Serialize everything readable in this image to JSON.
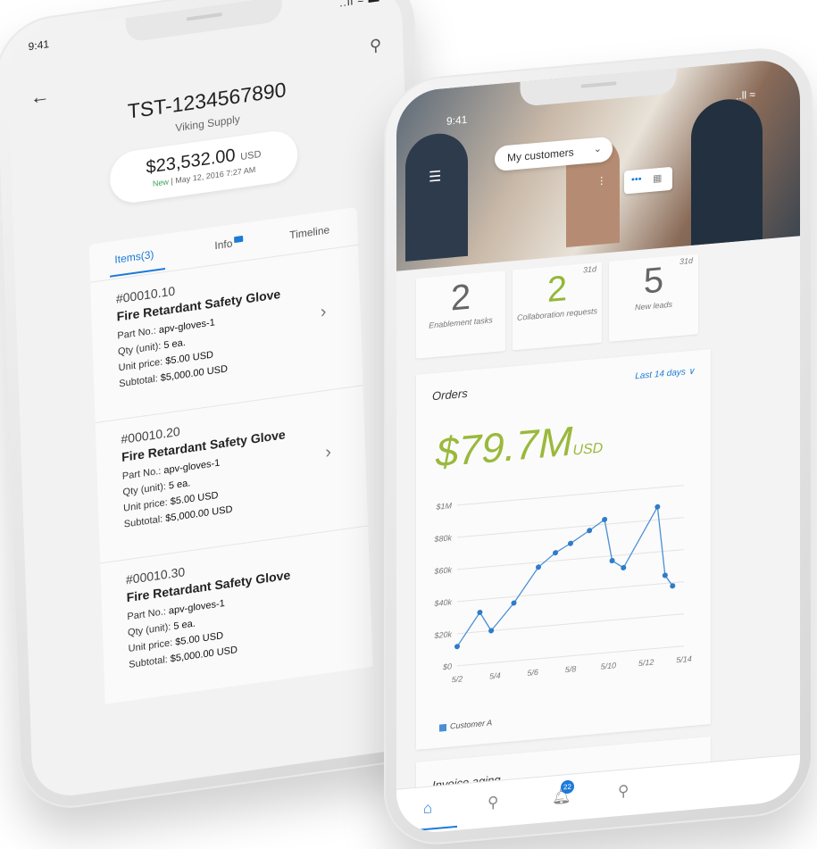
{
  "phone_left": {
    "status": {
      "time": "9:41",
      "signal": "..ll ≈ ▬"
    },
    "order_id": "TST-1234567890",
    "supplier": "Viking Supply",
    "amount": {
      "value": "$23,532.00",
      "currency": "USD",
      "status": "New",
      "date": "| May 12, 2016 7:27 AM"
    },
    "tabs": [
      {
        "label": "Items(3)"
      },
      {
        "label": "Info"
      },
      {
        "label": "Timeline"
      }
    ],
    "items": [
      {
        "number": "#00010.10",
        "title": "Fire Retardant Safety Glove",
        "part_label": "Part No.:",
        "part": "apv-gloves-1",
        "qty_label": "Qty (unit):",
        "qty": "5 ea.",
        "price_label": "Unit price:",
        "price": "$5.00 USD",
        "subtotal_label": "Subtotal:",
        "subtotal": "$5,000.00 USD"
      },
      {
        "number": "#00010.20",
        "title": "Fire Retardant Safety Glove",
        "part_label": "Part No.:",
        "part": "apv-gloves-1",
        "qty_label": "Qty (unit):",
        "qty": "5 ea.",
        "price_label": "Unit price:",
        "price": "$5.00 USD",
        "subtotal_label": "Subtotal:",
        "subtotal": "$5,000.00 USD"
      },
      {
        "number": "#00010.30",
        "title": "Fire Retardant Safety Glove",
        "part_label": "Part No.:",
        "part": "apv-gloves-1",
        "qty_label": "Qty (unit):",
        "qty": "5 ea.",
        "price_label": "Unit price:",
        "price": "$5.00 USD",
        "subtotal_label": "Subtotal:",
        "subtotal": "$5,000.00 USD"
      }
    ]
  },
  "phone_right": {
    "status": {
      "time": "9:41",
      "signal": "..ll ≈"
    },
    "selector": {
      "label": "My customers"
    },
    "kpis": [
      {
        "value": "2",
        "label": "Enablement tasks",
        "tag": ""
      },
      {
        "value": "2",
        "label": "Collaboration requests",
        "tag": "31d"
      },
      {
        "value": "5",
        "label": "New leads",
        "tag": "31d"
      }
    ],
    "orders": {
      "title": "Orders",
      "range": "Last 14 days ∨",
      "total": "$79.7M",
      "currency": "USD"
    },
    "invoice": {
      "title": "Invoice aging"
    },
    "tabbar": {
      "notifications_count": "22"
    }
  },
  "colors": {
    "accent": "#1c7ad8",
    "green": "#9ab93c",
    "series": "#4a8fd6"
  },
  "chart_data": {
    "type": "line",
    "title": "",
    "xlabel": "",
    "ylabel": "",
    "x_ticks": [
      "5/2",
      "5/4",
      "5/6",
      "5/8",
      "5/10",
      "5/12",
      "5/14"
    ],
    "y_ticks": [
      "$0",
      "$20k",
      "$40k",
      "$60k",
      "$80k",
      "$1M"
    ],
    "ylim": [
      0,
      100000
    ],
    "series": [
      {
        "name": "Customer A",
        "points": [
          {
            "x": 2.0,
            "y": 12000
          },
          {
            "x": 3.2,
            "y": 32000
          },
          {
            "x": 3.8,
            "y": 20000
          },
          {
            "x": 5.0,
            "y": 36000
          },
          {
            "x": 6.3,
            "y": 57000
          },
          {
            "x": 7.2,
            "y": 65000
          },
          {
            "x": 8.0,
            "y": 70000
          },
          {
            "x": 9.0,
            "y": 77000
          },
          {
            "x": 9.8,
            "y": 83000
          },
          {
            "x": 10.2,
            "y": 57000
          },
          {
            "x": 10.8,
            "y": 52000
          },
          {
            "x": 12.6,
            "y": 88000
          },
          {
            "x": 13.0,
            "y": 45000
          },
          {
            "x": 13.4,
            "y": 38000
          }
        ]
      }
    ],
    "legend_position": "bottom-left"
  }
}
